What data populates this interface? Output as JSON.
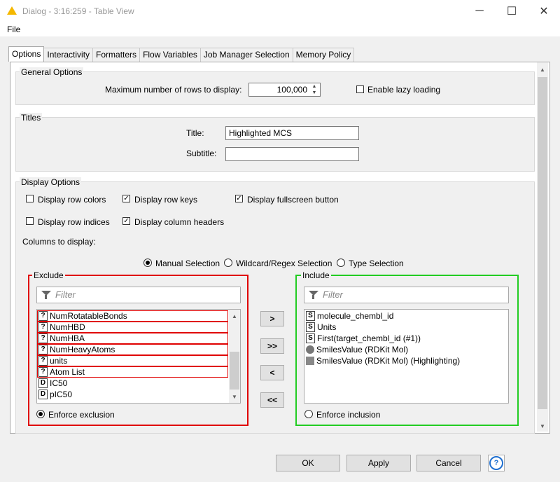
{
  "window": {
    "title": "Dialog - 3:16:259 - Table View",
    "minimize": "─",
    "maximize": "☐",
    "close": "✕"
  },
  "menu": {
    "file": "File"
  },
  "tabs": [
    "Options",
    "Interactivity",
    "Formatters",
    "Flow Variables",
    "Job Manager Selection",
    "Memory Policy"
  ],
  "general": {
    "title": "General Options",
    "max_rows_label": "Maximum number of rows to display:",
    "max_rows_value": "100,000",
    "lazy_loading_label": "Enable lazy loading",
    "lazy_loading": false
  },
  "titles": {
    "title": "Titles",
    "title_label": "Title:",
    "title_value": "Highlighted MCS",
    "subtitle_label": "Subtitle:",
    "subtitle_value": ""
  },
  "display": {
    "title": "Display Options",
    "row_colors": "Display row colors",
    "row_keys": "Display row keys",
    "fullscreen": "Display fullscreen button",
    "row_indices": "Display row indices",
    "column_headers": "Display column headers",
    "checked": {
      "row_colors": false,
      "row_keys": true,
      "fullscreen": true,
      "row_indices": false,
      "column_headers": true
    },
    "columns_label": "Columns to display:"
  },
  "selection_modes": [
    "Manual Selection",
    "Wildcard/Regex Selection",
    "Type Selection"
  ],
  "selected_mode": "Manual Selection",
  "exclude": {
    "title": "Exclude",
    "filter_placeholder": "Filter",
    "items": [
      {
        "type": "?",
        "name": "NumRotatableBonds"
      },
      {
        "type": "?",
        "name": "NumHBD"
      },
      {
        "type": "?",
        "name": "NumHBA"
      },
      {
        "type": "?",
        "name": "NumHeavyAtoms"
      },
      {
        "type": "?",
        "name": "units"
      },
      {
        "type": "?",
        "name": "Atom List"
      },
      {
        "type": "D",
        "name": "IC50"
      },
      {
        "type": "D",
        "name": "pIC50"
      }
    ],
    "enforce_label": "Enforce exclusion"
  },
  "include": {
    "title": "Include",
    "filter_placeholder": "Filter",
    "items": [
      {
        "type": "S",
        "name": "molecule_chembl_id"
      },
      {
        "type": "S",
        "name": "Units"
      },
      {
        "type": "S",
        "name": "First(target_chembl_id (#1))"
      },
      {
        "type": "mol",
        "name": "SmilesValue (RDKit Mol)"
      },
      {
        "type": "mol2",
        "name": "SmilesValue (RDKit Mol) (Highlighting)"
      }
    ],
    "enforce_label": "Enforce inclusion"
  },
  "move_buttons": [
    ">",
    ">>",
    "<",
    "<<"
  ],
  "buttons": {
    "ok": "OK",
    "apply": "Apply",
    "cancel": "Cancel",
    "help": "?"
  },
  "colors": {
    "exclude_border": "#e00000",
    "include_border": "#22cc22"
  }
}
